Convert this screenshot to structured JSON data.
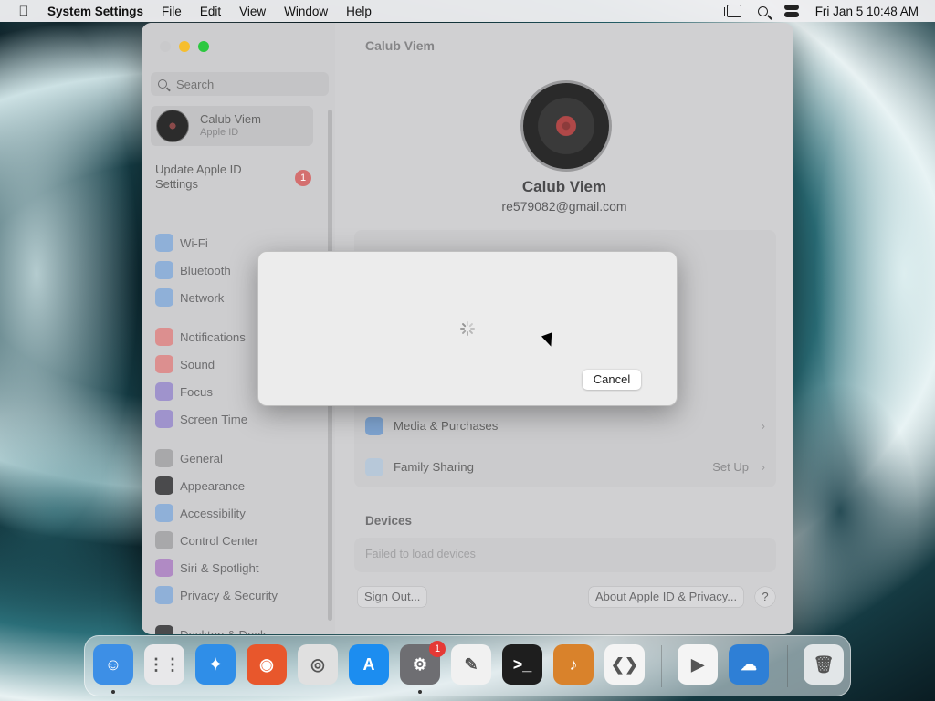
{
  "menubar": {
    "app_name": "System Settings",
    "menus": [
      "File",
      "Edit",
      "View",
      "Window",
      "Help"
    ],
    "datetime": "Fri Jan 5  10:48 AM"
  },
  "sidebar": {
    "search_placeholder": "Search",
    "user": {
      "name": "Calub Viem",
      "subtitle": "Apple ID"
    },
    "update": {
      "label": "Update Apple ID Settings",
      "badge": "1"
    },
    "items": [
      {
        "label": "Wi-Fi",
        "icon": "wifi-icon",
        "color": "#8fb0d8"
      },
      {
        "label": "Bluetooth",
        "icon": "bluetooth-icon",
        "color": "#8fb0d8"
      },
      {
        "label": "Network",
        "icon": "globe-icon",
        "color": "#8fb0d8"
      },
      {
        "label": "Notifications",
        "icon": "bell-icon",
        "color": "#dc8f8f"
      },
      {
        "label": "Sound",
        "icon": "speaker-icon",
        "color": "#dc8f8f"
      },
      {
        "label": "Focus",
        "icon": "moon-icon",
        "color": "#9f93cc"
      },
      {
        "label": "Screen Time",
        "icon": "hourglass-icon",
        "color": "#9f93cc"
      },
      {
        "label": "General",
        "icon": "gear-icon",
        "color": "#a8a8aa"
      },
      {
        "label": "Appearance",
        "icon": "appearance-icon",
        "color": "#4a4a4c"
      },
      {
        "label": "Accessibility",
        "icon": "accessibility-icon",
        "color": "#8fb0d8"
      },
      {
        "label": "Control Center",
        "icon": "control-center-icon",
        "color": "#a8a8aa"
      },
      {
        "label": "Siri & Spotlight",
        "icon": "siri-icon",
        "color": "#b08ac4"
      },
      {
        "label": "Privacy & Security",
        "icon": "hand-icon",
        "color": "#8fb0d8"
      },
      {
        "label": "Desktop & Dock",
        "icon": "dock-icon",
        "color": "#4a4a4c"
      }
    ]
  },
  "content": {
    "title": "Calub Viem",
    "name": "Calub Viem",
    "email": "re579082@gmail.com",
    "rows": [
      {
        "label": "Media & Purchases",
        "value": ""
      },
      {
        "label": "Family Sharing",
        "value": "Set Up"
      }
    ],
    "devices_header": "Devices",
    "devices_status": "Failed to load devices",
    "sign_out": "Sign Out...",
    "about": "About Apple ID & Privacy...",
    "help": "?"
  },
  "sheet": {
    "cancel": "Cancel"
  },
  "dock": {
    "apps": [
      {
        "name": "Finder",
        "color": "#3d8fe6",
        "glyph": "☺"
      },
      {
        "name": "Launchpad",
        "color": "#e8e8ea",
        "glyph": "⋮⋮"
      },
      {
        "name": "Safari",
        "color": "#2f8ee8",
        "glyph": "✦"
      },
      {
        "name": "Firefox",
        "color": "#e8572c",
        "glyph": "◉"
      },
      {
        "name": "Chrome",
        "color": "#e0e0e0",
        "glyph": "◎"
      },
      {
        "name": "App Store",
        "color": "#1c8df0",
        "glyph": "A"
      },
      {
        "name": "System Settings",
        "color": "#6e6e72",
        "glyph": "⚙",
        "badge": "1"
      },
      {
        "name": "TextEdit",
        "color": "#f1f1f1",
        "glyph": "✎"
      },
      {
        "name": "Terminal",
        "color": "#1e1e1e",
        "glyph": ">_"
      },
      {
        "name": "Instruments",
        "color": "#d9822b",
        "glyph": "♪"
      },
      {
        "name": "VS Code",
        "color": "#f4f4f4",
        "glyph": "❮❯"
      },
      {
        "name": "Visual Studio",
        "color": "#f4f4f4",
        "glyph": "▶"
      },
      {
        "name": "Weather",
        "color": "#2e7fd6",
        "glyph": "☁"
      },
      {
        "name": "Trash",
        "color": "#e2e6e8",
        "glyph": "🗑"
      }
    ]
  }
}
